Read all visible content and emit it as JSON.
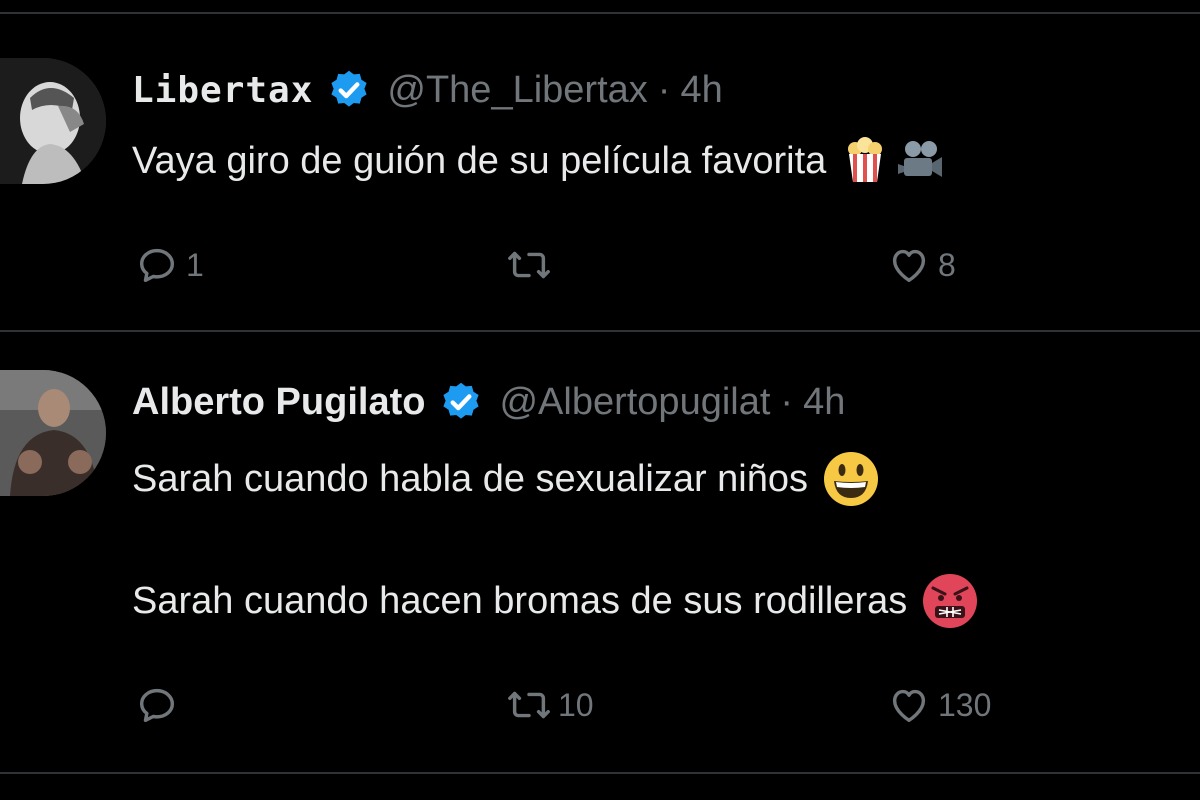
{
  "tweets": [
    {
      "name": "Libertax",
      "handle": "@The_Libertax",
      "separator": "·",
      "time": "4h",
      "text": "Vaya giro de guión de su película favorita",
      "emojis": [
        "popcorn-emoji",
        "movie-camera-emoji"
      ],
      "replies": "1",
      "retweets": "",
      "likes": "8"
    },
    {
      "name": "Alberto Pugilato",
      "handle": "@Albertopugilat",
      "separator": "·",
      "time": "4h",
      "line1": "Sarah cuando habla de sexualizar niños",
      "line2": "Sarah cuando hacen bromas de sus rodilleras",
      "emojis": [
        "grinning-face-emoji",
        "angry-face-emoji"
      ],
      "replies": "",
      "retweets": "10",
      "likes": "130"
    }
  ],
  "colors": {
    "background": "#000000",
    "text": "#e7e9ea",
    "muted": "#71767b",
    "verified": "#1d9bf0",
    "divider": "#2f3336"
  }
}
